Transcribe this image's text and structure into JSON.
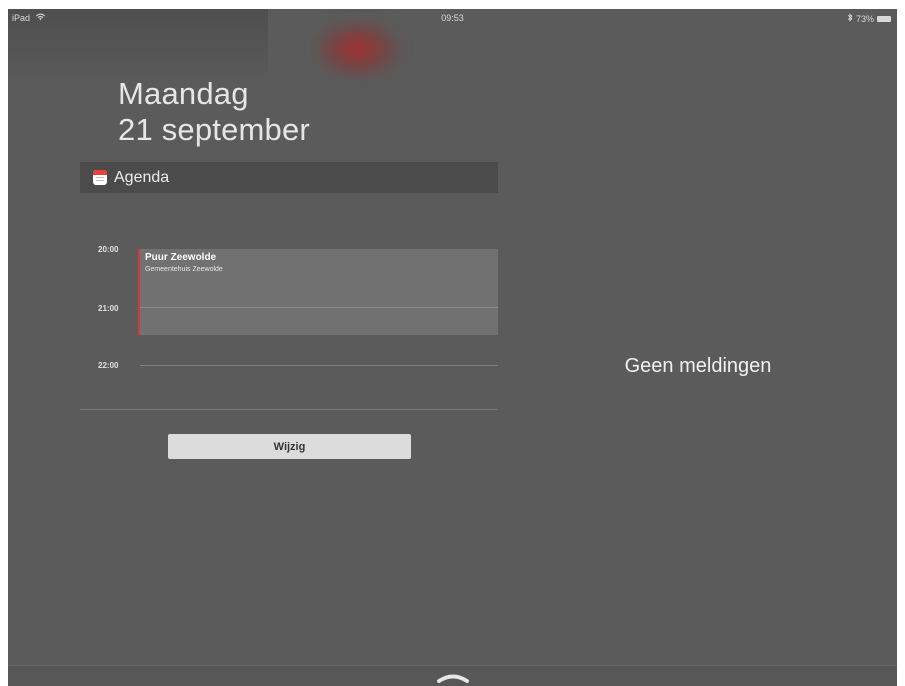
{
  "status_bar": {
    "device": "iPad",
    "time": "09:53",
    "battery": "73%"
  },
  "date": {
    "day": "Maandag",
    "full": "21 september"
  },
  "widget": {
    "title": "Agenda",
    "icon": "calendar-icon",
    "hours": [
      "20:00",
      "21:00",
      "22:00"
    ],
    "event": {
      "title": "Puur Zeewolde",
      "location": "Gemeentehuis Zeewolde",
      "color": "#d9383b"
    },
    "edit_label": "Wijzig"
  },
  "notifications": {
    "empty_text": "Geen meldingen"
  },
  "bottom": {
    "grabber_icon": "chevron-up-icon"
  }
}
